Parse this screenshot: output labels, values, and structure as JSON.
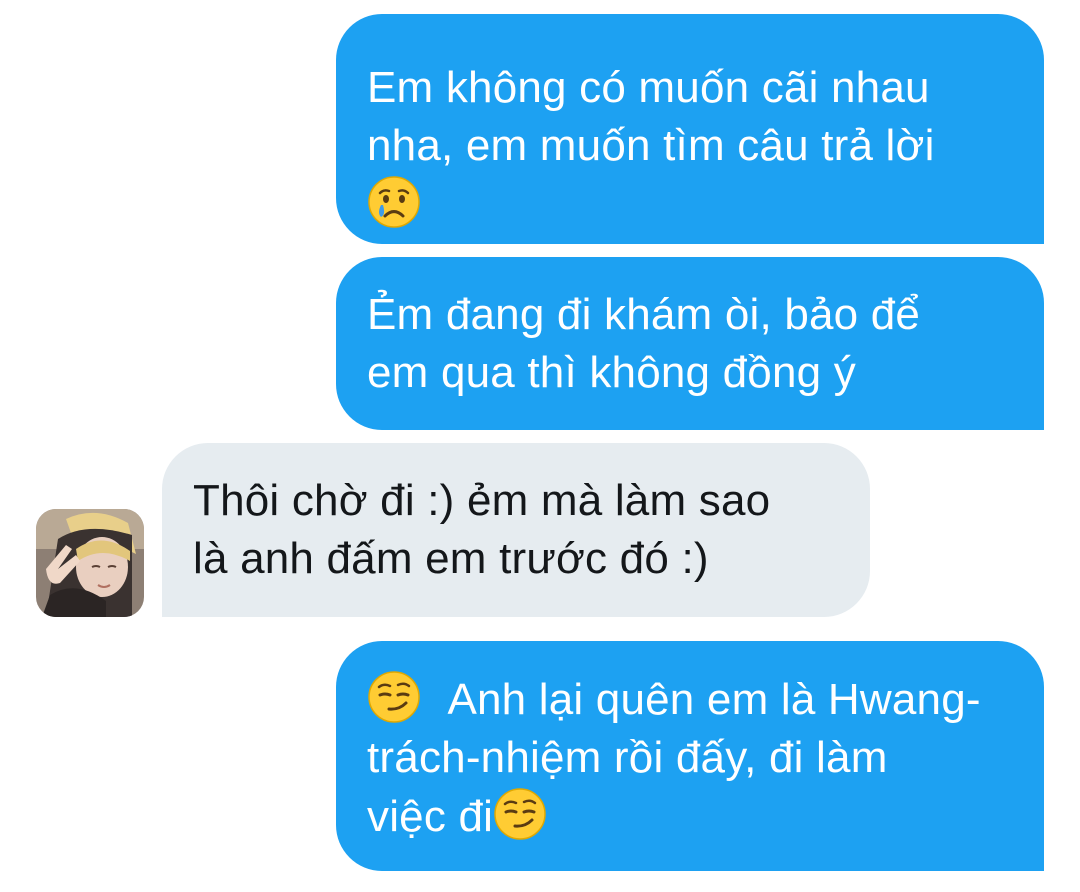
{
  "conversation": {
    "messages": [
      {
        "direction": "sent",
        "lines": [
          "Em không có muốn cãi nhau",
          "nha, em muốn tìm câu trả lời"
        ],
        "trailing_emoji": "crying-face-icon"
      },
      {
        "direction": "sent",
        "lines": [
          "Ẻm đang đi khám òi, bảo để",
          "em qua thì không đồng ý"
        ]
      },
      {
        "direction": "received",
        "lines": [
          "Thôi chờ đi :) ẻm mà làm sao",
          "là anh đấm em trước đó :)"
        ]
      },
      {
        "direction": "sent",
        "leading_emoji": "smirking-face-icon",
        "lines": [
          "Anh lại quên em là Hwang-",
          "trách-nhiệm rồi đấy, đi làm",
          "việc đi"
        ],
        "trailing_emoji": "smirking-face-icon"
      }
    ]
  },
  "colors": {
    "sent_bubble": "#1da1f2",
    "received_bubble": "#e6ecf0",
    "sent_text": "#ffffff",
    "received_text": "#14171a"
  }
}
